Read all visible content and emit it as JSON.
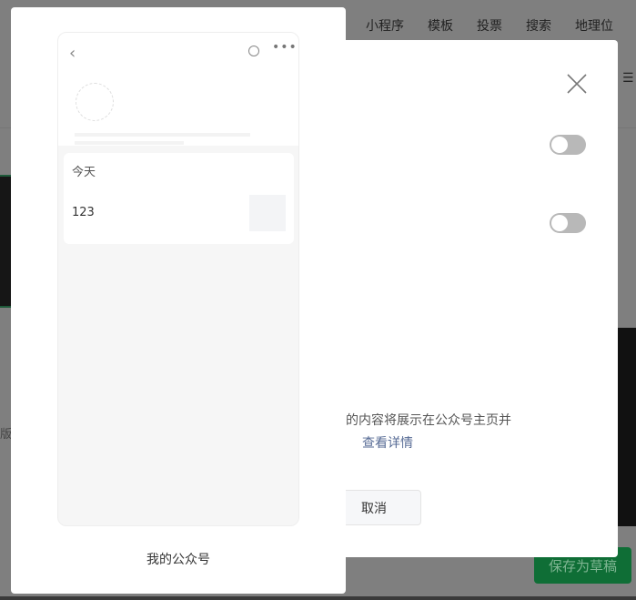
{
  "background": {
    "tabs": [
      "小程序",
      "模板",
      "投票",
      "搜索",
      "地理位"
    ],
    "left_text": "版",
    "save_draft": "保存为草稿"
  },
  "dialog": {
    "description": "的内容将展示在公众号主页并",
    "details_link": "查看详情",
    "cancel": "取消",
    "toggles": [
      false,
      false
    ]
  },
  "preview": {
    "section_title": "今天",
    "article_title": "123",
    "account_name": "我的公众号"
  },
  "colors": {
    "accent": "#0f6e36",
    "link": "#576b95"
  }
}
